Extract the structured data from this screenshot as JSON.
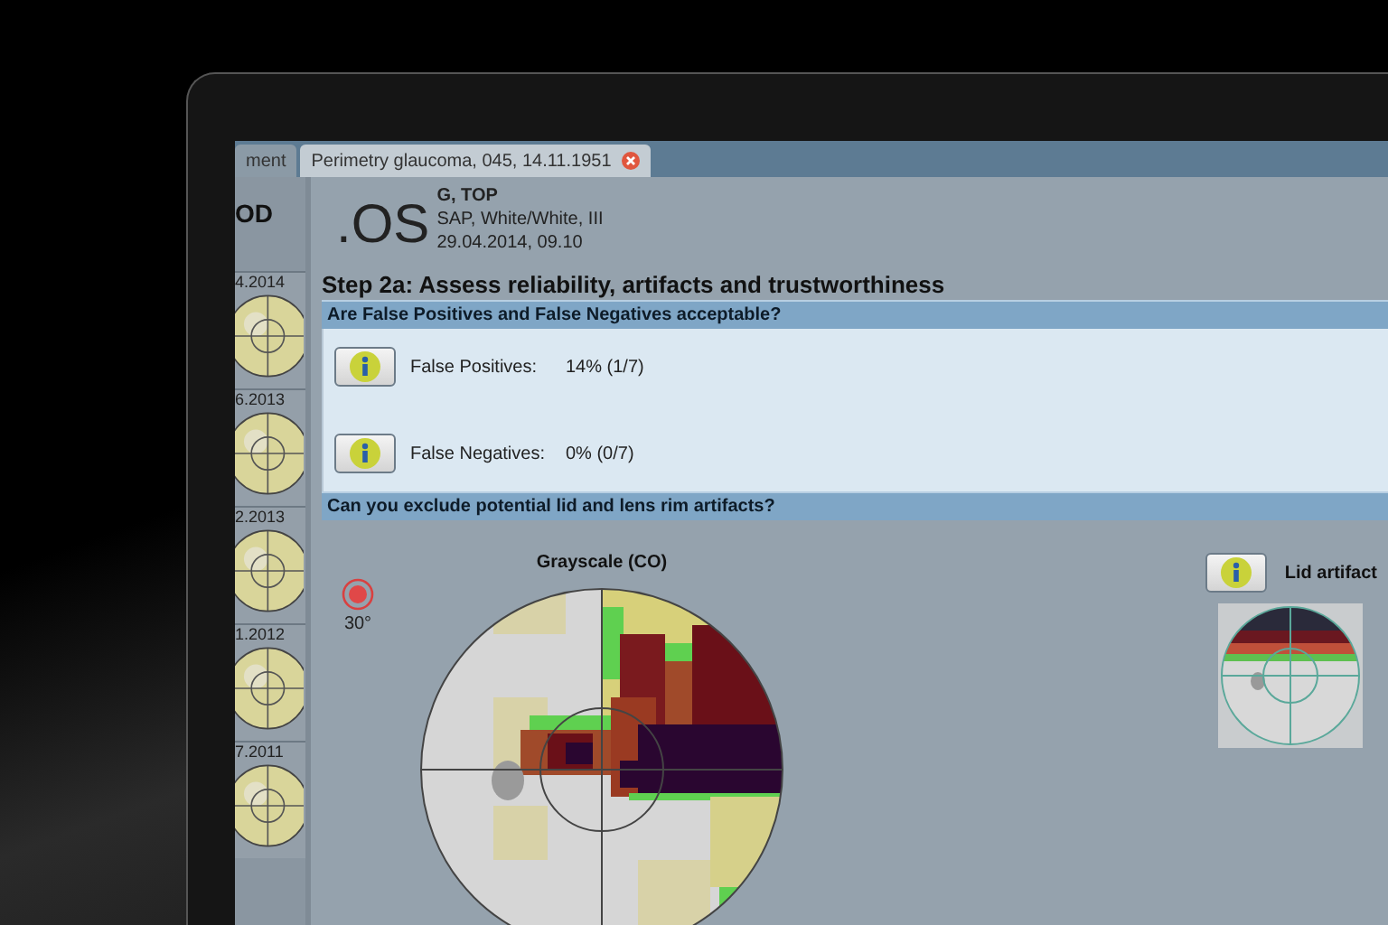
{
  "tabs": [
    {
      "label": "ment",
      "selected": false
    },
    {
      "label": "Perimetry glaucoma, 045, 14.11.1951",
      "selected": true
    }
  ],
  "sidebar": {
    "eye": "OD",
    "thumbnails": [
      {
        "date": "4.2014"
      },
      {
        "date": "6.2013"
      },
      {
        "date": "2.2013"
      },
      {
        "date": "1.2012"
      },
      {
        "date": "7.2011"
      }
    ]
  },
  "exam": {
    "eye": ".OS",
    "patient": "G, TOP",
    "test": "SAP, White/White, III",
    "datetime": "29.04.2014, 09.10"
  },
  "step_title": "Step 2a: Assess reliability, artifacts and trustworthiness",
  "sections": [
    {
      "question": "Are False Positives and False Negatives acceptable?",
      "rows": [
        {
          "label": "False Positives:",
          "value": "14% (1/7)"
        },
        {
          "label": "False Negatives:",
          "value": "0% (0/7)"
        }
      ]
    },
    {
      "question": "Can you exclude potential lid and lens rim artifacts?"
    }
  ],
  "stimulus": {
    "label": "30°"
  },
  "plot_title": "Grayscale (CO)",
  "lid_artifact": {
    "label": "Lid artifact"
  }
}
